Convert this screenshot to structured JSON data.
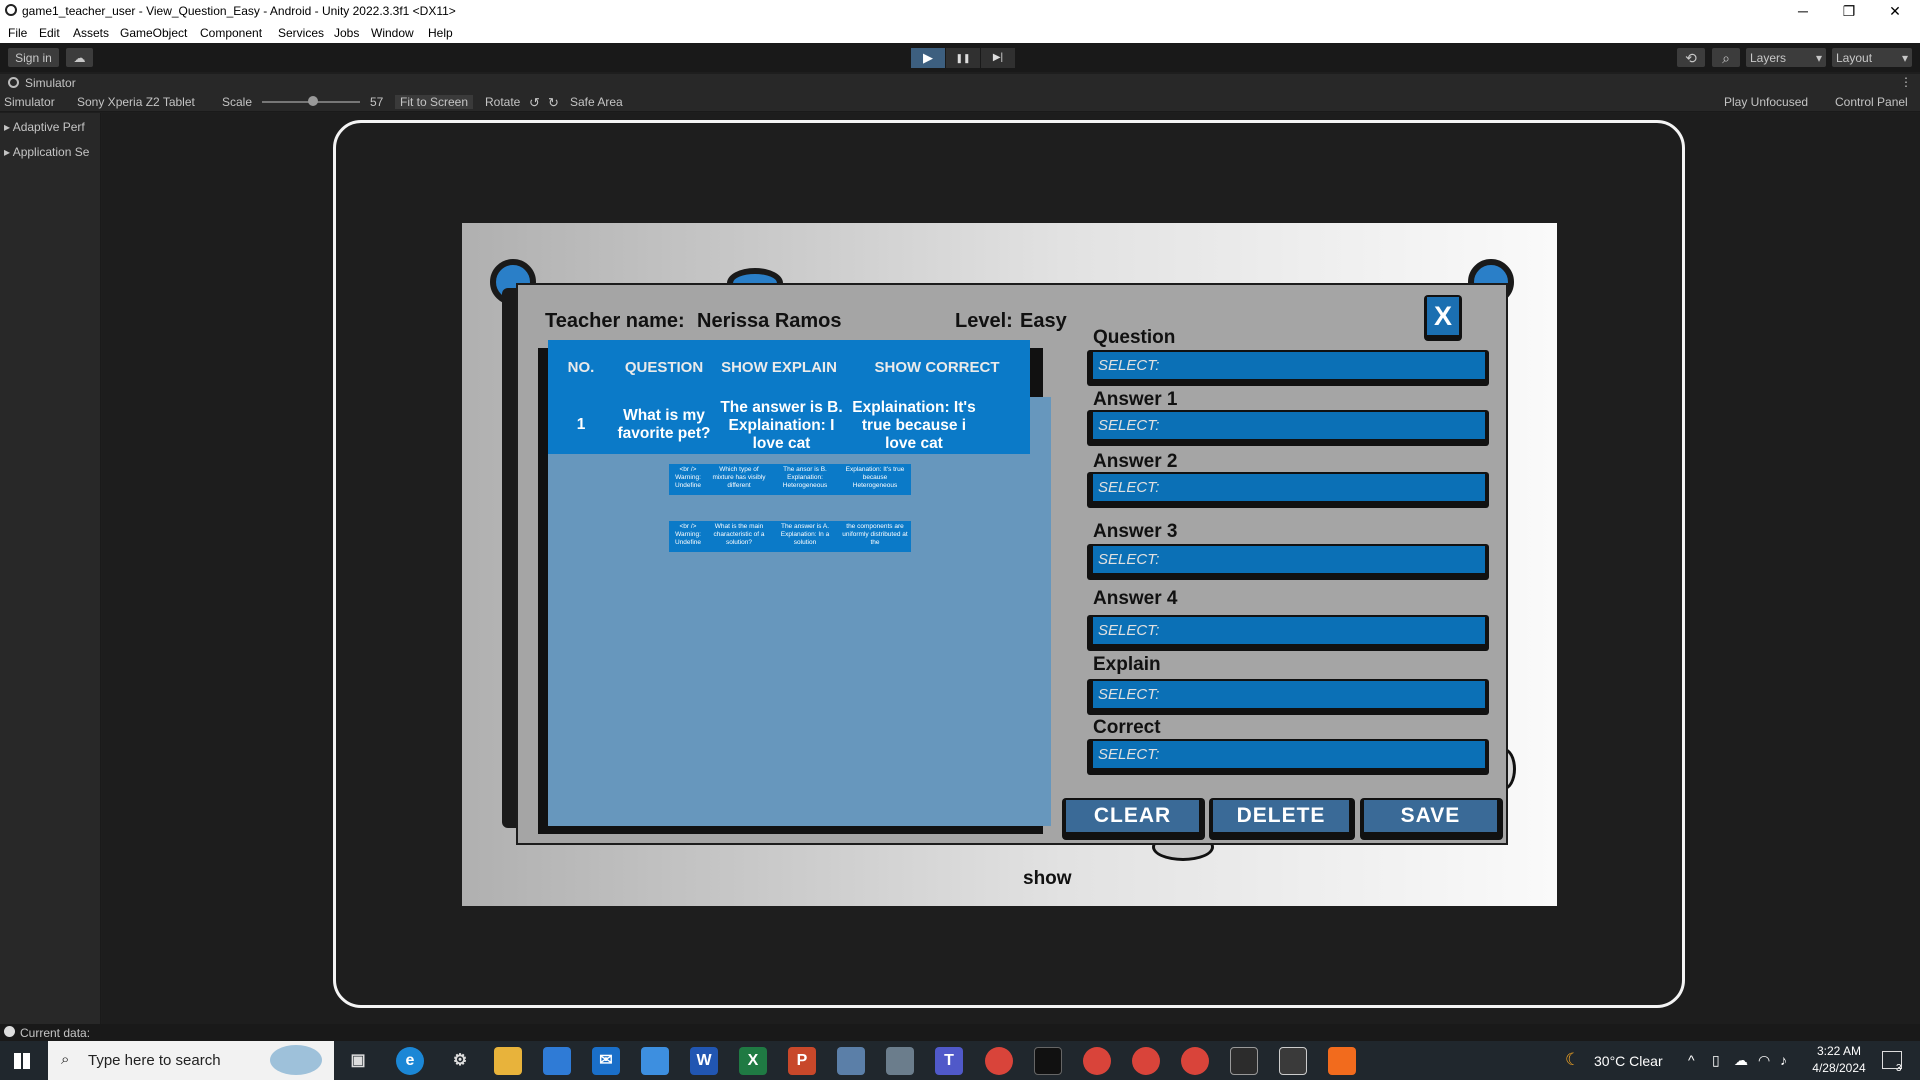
{
  "window": {
    "title": "game1_teacher_user - View_Question_Easy - Android - Unity 2022.3.3f1 <DX11>",
    "minimize": "─",
    "maximize": "❐",
    "close": "✕"
  },
  "menu": [
    "File",
    "Edit",
    "Assets",
    "GameObject",
    "Component",
    "Services",
    "Jobs",
    "Window",
    "Help"
  ],
  "toolbar": {
    "sign_in": "Sign in",
    "cloud": "☁",
    "play": "▶",
    "pause": "❚❚",
    "step": "▶|",
    "history": "⟲",
    "search": "⌕",
    "layers": "Layers",
    "layout": "Layout",
    "dropdown": "▾"
  },
  "simulator": {
    "tab": "Simulator",
    "mode": "Simulator",
    "device": "Sony Xperia Z2 Tablet",
    "scale_label": "Scale",
    "scale_value": "57",
    "fit": "Fit to Screen",
    "rotate": "Rotate",
    "safe_area": "Safe Area",
    "play_mode": "Play Unfocused",
    "control_panel": "Control Panel",
    "more": "⋮"
  },
  "left_panel": [
    "Adaptive Perf",
    "Application Se"
  ],
  "game": {
    "teacher_label": "Teacher name:",
    "teacher_name": "Nerissa Ramos",
    "level_label": "Level:",
    "level_value": "Easy",
    "table": {
      "headers": [
        "NO.",
        "QUESTION",
        "SHOW EXPLAIN",
        "SHOW CORRECT"
      ],
      "rows": [
        {
          "no": "1",
          "question": "What is my favorite pet?",
          "explain": "The answer is B. Explaination: I love cat",
          "correct": "Explaination: It's true because i love cat"
        }
      ]
    },
    "mini_rows": [
      [
        "<br /> Warning: Undefine",
        "Which type of mixture has visibly different",
        "The ansor is B. Explanation: Heterogeneous",
        "Explanation: It's true because Heterogeneous"
      ],
      [
        "<br /> Warning: Undefine",
        "What is the main characteristic of a solution?",
        "The answer is A. Explanation: In a solution",
        "the components are uniformly distributed at the"
      ]
    ],
    "fields": [
      {
        "label": "Question",
        "value": "SELECT:"
      },
      {
        "label": "Answer 1",
        "value": "SELECT:"
      },
      {
        "label": "Answer 2",
        "value": "SELECT:"
      },
      {
        "label": "Answer 3",
        "value": "SELECT:"
      },
      {
        "label": "Answer 4",
        "value": "SELECT:"
      },
      {
        "label": "Explain",
        "value": "SELECT:"
      },
      {
        "label": "Correct",
        "value": "SELECT:"
      }
    ],
    "close": "X",
    "clear": "CLEAR",
    "delete": "DELETE",
    "save": "SAVE",
    "show": "show"
  },
  "status": {
    "text": "Current data:"
  },
  "taskbar": {
    "search_placeholder": "Type here to search",
    "weather": "30°C  Clear",
    "time": "3:22 AM",
    "date": "4/28/2024",
    "notif_count": "3"
  }
}
